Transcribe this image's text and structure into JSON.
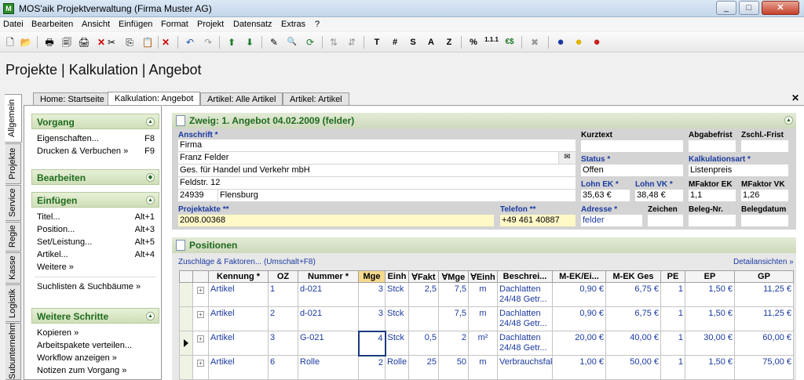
{
  "window": {
    "title": "MOS'aik Projektverwaltung (Firma Muster AG)",
    "app_icon": "M",
    "minimize": "_",
    "maximize": "□",
    "close": "✕"
  },
  "menu": [
    "Datei",
    "Bearbeiten",
    "Ansicht",
    "Einfügen",
    "Format",
    "Projekt",
    "Datensatz",
    "Extras",
    "?"
  ],
  "toolbar": {
    "icons": [
      "new-icon",
      "open-icon",
      "print-icon",
      "print-preview-icon",
      "print-setup-icon",
      "delete-icon",
      "cut-icon",
      "copy-icon",
      "paste-icon",
      "undo-icon",
      "redo-icon",
      "move-up-icon",
      "move-down-icon",
      "edit-icon",
      "search-icon",
      "refresh-icon",
      "sort-asc-icon",
      "sort-desc-icon",
      "percent-icon",
      "numbering-icon",
      "currency-icon",
      "tools-icon",
      "user-blue-icon",
      "user-yellow-icon",
      "user-red-icon"
    ],
    "text_buttons": [
      "T",
      "#",
      "S",
      "A",
      "Z"
    ],
    "glyphs": {
      "new": "🗋",
      "open": "📂",
      "print": "🖶",
      "print_preview": "🗐",
      "print_setup": "🖨",
      "delete": "✕",
      "cut": "✂",
      "copy": "⎘",
      "paste": "📋",
      "undo": "↶",
      "redo": "↷",
      "move_up": "⬆",
      "move_down": "⬇",
      "edit": "✎",
      "search": "🔍",
      "refresh": "⟳",
      "sort_asc": "⇅",
      "sort_desc": "⇵",
      "percent": "%",
      "numbering": "1.1.1",
      "currency": "€$",
      "tools": "✖",
      "user": "●"
    }
  },
  "page_title": "Projekte | Kalkulation | Angebot",
  "doc_tabs": [
    "Home: Startseite",
    "Kalkulation: Angebot",
    "Artikel: Alle Artikel",
    "Artikel: Artikel"
  ],
  "doc_close": "✕",
  "side_tabs": [
    "Allgemein",
    "Projekte",
    "Service",
    "Regie",
    "Kasse",
    "Logistik",
    "Subunternehmer"
  ],
  "left": {
    "vorgang": {
      "title": "Vorgang",
      "items": [
        {
          "label": "Eigenschaften...",
          "shortcut": "F8"
        },
        {
          "label": "Drucken & Verbuchen »",
          "shortcut": "F9"
        }
      ]
    },
    "bearbeiten": {
      "title": "Bearbeiten"
    },
    "einfuegen": {
      "title": "Einfügen",
      "items": [
        {
          "label": "Titel...",
          "shortcut": "Alt+1"
        },
        {
          "label": "Position...",
          "shortcut": "Alt+3"
        },
        {
          "label": "Set/Leistung...",
          "shortcut": "Alt+5"
        },
        {
          "label": "Artikel...",
          "shortcut": "Alt+4"
        },
        {
          "label": "Weitere »",
          "shortcut": ""
        }
      ],
      "extra": "Suchlisten & Suchbäume »"
    },
    "weitere": {
      "title": "Weitere Schritte",
      "items": [
        "Kopieren »",
        "Arbeitspakete verteilen...",
        "Workflow anzeigen »",
        "Notizen zum Vorgang »"
      ]
    }
  },
  "header": {
    "title": "Zweig: 1. Angebot 04.02.2009 (felder)",
    "anschrift_label": "Anschrift *",
    "address": [
      "Firma",
      "Franz Felder",
      "Ges. für Handel und Verkehr mbH",
      "Feldstr. 12"
    ],
    "plz": "24939",
    "ort": "Flensburg",
    "kurztext_label": "Kurztext",
    "kurztext": "",
    "abgabefrist_label": "Abgabefrist",
    "abgabefrist": "",
    "zschl_label": "Zschl.-Frist",
    "zschl": "",
    "status_label": "Status *",
    "status": "Offen",
    "kalkart_label": "Kalkulationsart *",
    "kalkart": "Listenpreis",
    "lohnek_label": "Lohn EK *",
    "lohnek": "35,63 €",
    "lohnvk_label": "Lohn VK *",
    "lohnvk": "38,48 €",
    "mfek_label": "MFaktor EK",
    "mfek": "1,1",
    "mfvk_label": "MFaktor VK",
    "mfvk": "1,26",
    "projektakte_label": "Projektakte **",
    "projektakte": "2008.00368",
    "telefon_label": "Telefon **",
    "telefon": "+49 461 40887",
    "adresse_label": "Adresse *",
    "adresse": "felder",
    "zeichen_label": "Zeichen",
    "zeichen": "",
    "belegnr_label": "Beleg-Nr.",
    "belegnr": "",
    "belegdatum_label": "Belegdatum",
    "belegdatum": "",
    "address_icon": "✉"
  },
  "positions": {
    "title": "Positionen",
    "zuschlaege_link": "Zuschläge & Faktoren... (Umschalt+F8)",
    "details_link": "Detailansichten »",
    "columns": [
      "Kennung *",
      "OZ",
      "Nummer *",
      "Mge",
      "Einh",
      "∀Fakt",
      "∀Mge",
      "∀Einh",
      "Beschrei...",
      "M-EK/Ei...",
      "M-EK Ges",
      "PE",
      "EP",
      "GP"
    ],
    "rows": [
      [
        "Artikel",
        "1",
        "d-021",
        "3",
        "Stck",
        "2,5",
        "7,5",
        "m",
        "Dachlatten 24/48 Getr...",
        "0,90 €",
        "6,75 €",
        "1",
        "1,50 €",
        "11,25 €"
      ],
      [
        "Artikel",
        "2",
        "d-021",
        "3",
        "Stck",
        "",
        "7,5",
        "m",
        "Dachlatten 24/48 Getr...",
        "0,90 €",
        "6,75 €",
        "1",
        "1,50 €",
        "11,25 €"
      ],
      [
        "Artikel",
        "3",
        "G-021",
        "4",
        "Stck",
        "0,5",
        "2",
        "m²",
        "Dachlatten 24/48 Getr...",
        "20,00 €",
        "40,00 €",
        "1",
        "30,00 €",
        "60,00 €"
      ],
      [
        "Artikel",
        "6",
        "Rolle",
        "2",
        "Rolle",
        "25",
        "50",
        "m",
        "Verbrauchsfaktor",
        "1,00 €",
        "50,00 €",
        "1",
        "1,50 €",
        "75,00 €"
      ]
    ],
    "current_row": 2
  }
}
